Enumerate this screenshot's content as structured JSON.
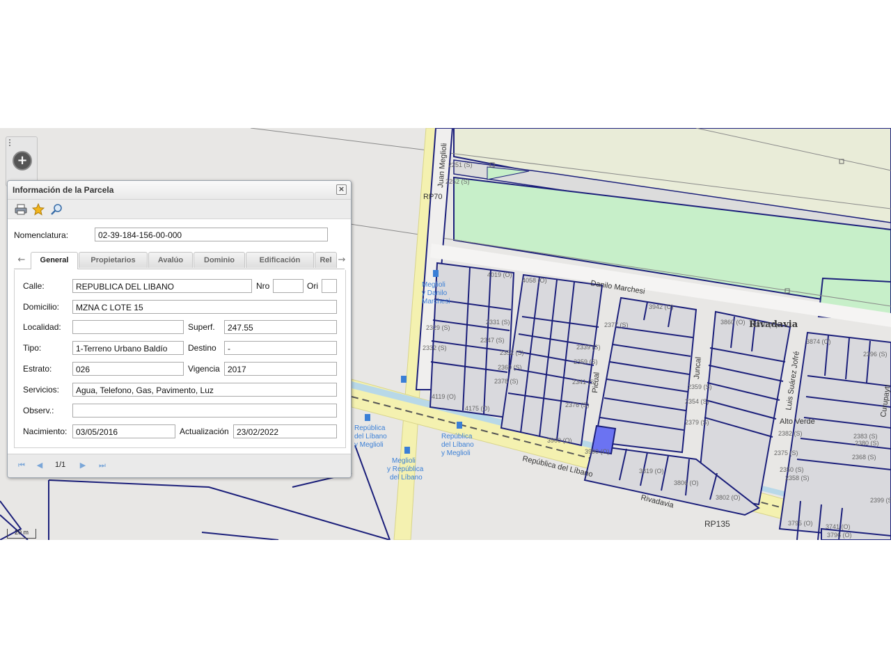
{
  "panel": {
    "title": "Información de la Parcela",
    "close_label": "×",
    "nomenclatura": {
      "label": "Nomenclatura:",
      "value": "02-39-184-156-00-000"
    },
    "tabs": [
      {
        "label": "General",
        "active": true
      },
      {
        "label": "Propietarios"
      },
      {
        "label": "Avalúo"
      },
      {
        "label": "Dominio"
      },
      {
        "label": "Edificación"
      },
      {
        "label": "Rel"
      }
    ],
    "fields": {
      "calle": {
        "label": "Calle:",
        "value": "REPUBLICA DEL LIBANO"
      },
      "nro": {
        "label": "Nro",
        "value": ""
      },
      "ori": {
        "label": "Ori",
        "value": ""
      },
      "domicilio": {
        "label": "Domicilio:",
        "value": "MZNA C LOTE 15"
      },
      "localidad": {
        "label": "Localidad:",
        "value": ""
      },
      "superf": {
        "label": "Superf.",
        "value": "247.55"
      },
      "tipo": {
        "label": "Tipo:",
        "value": "1-Terreno Urbano Baldío"
      },
      "destino": {
        "label": "Destino",
        "value": "-"
      },
      "estrato": {
        "label": "Estrato:",
        "value": "026"
      },
      "vigencia": {
        "label": "Vigencia",
        "value": "2017"
      },
      "servicios": {
        "label": "Servicios:",
        "value": "Agua, Telefono, Gas, Pavimento, Luz"
      },
      "observ": {
        "label": "Observ.:",
        "value": ""
      },
      "nacimiento": {
        "label": "Nacimiento:",
        "value": "03/05/2016"
      },
      "actualizacion": {
        "label": "Actualización",
        "value": "23/02/2022"
      }
    },
    "pager": {
      "text": "1/1"
    }
  },
  "map": {
    "streets": {
      "juan_meglioli": "Juan Meglioli",
      "rp70": "RP70",
      "danilo_marchesi": "Danilo Marchesi",
      "rivadavia_area": "Rivadavia",
      "picual": "Picual",
      "juncal": "Juncal",
      "luis_suarez_jofre": "Luis Suárez Jofré",
      "curupayti": "Curupayti",
      "republica_libano": "República del Líbano",
      "rivadavia_road": "Rivadavia",
      "rp135": "RP135",
      "alto_verde": "Alto Verde"
    },
    "stops": {
      "stop1": [
        "Meglioli",
        "y Danilo",
        "Marchesi"
      ],
      "stop2": [
        "República",
        "del Líbano",
        "y Meglioli"
      ],
      "stop3": [
        "Meglioli",
        "y República",
        "del Líbano"
      ],
      "stop4": [
        "República",
        "del Líbano",
        "y Meglioli"
      ]
    },
    "parcel_numbers": [
      "2251 (S)",
      "2252 (S)",
      "4019 (O)",
      "4058 (O)",
      "2329 (S)",
      "2332 (S)",
      "2331 (S)",
      "2347 (S)",
      "2352 (S)",
      "2360 (S)",
      "2378 (S)",
      "4119 (O)",
      "4175 (O)",
      "2339 (S)",
      "2359 (S)",
      "2376 (S)",
      "2377 (S)",
      "2341 (S)",
      "3900 (O)",
      "3990 (O)",
      "2350 (S)",
      "2358 (S)",
      "2368 (S)",
      "2380 (S)",
      "2396 (S)",
      "3819 (O)",
      "3860 (O)",
      "3870 (O)",
      "3942 (O)",
      "2359 (S)",
      "2379 (S)",
      "2399 (S)",
      "2354 (S)",
      "2375 (S)",
      "2382 (S)",
      "2383 (S)",
      "3802 (O)",
      "3806 (O)",
      "3874 (O)",
      "3796 (O)",
      "3795 (O)",
      "3741 (O)"
    ],
    "scale": "20 m",
    "colors": {
      "parcel": "#d9d9dd",
      "line": "#1b1f7a",
      "green": "#c7efc9",
      "selected": "#6b73f2",
      "road": "#f2f0a6"
    }
  }
}
